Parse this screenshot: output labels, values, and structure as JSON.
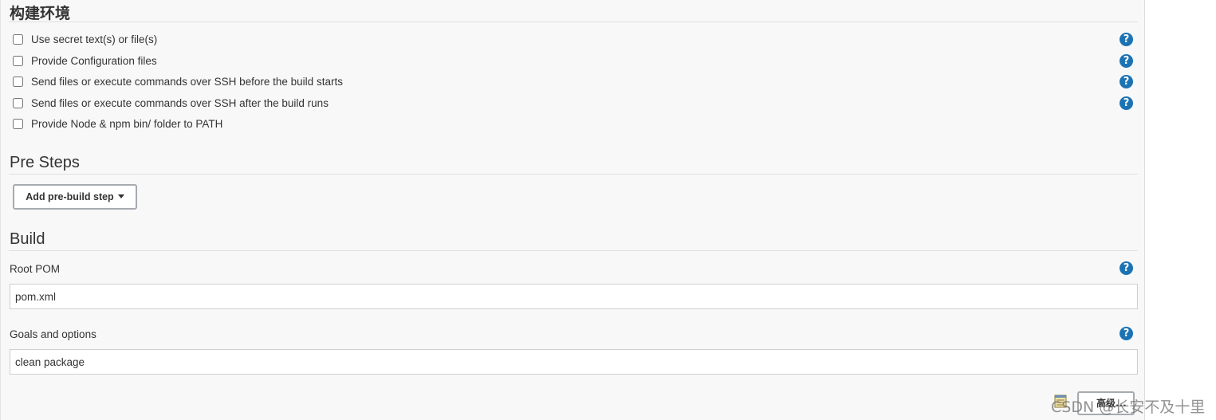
{
  "build_env": {
    "title": "构建环境",
    "options": [
      {
        "label": "Use secret text(s) or file(s)",
        "checked": false,
        "has_help": true
      },
      {
        "label": "Provide Configuration files",
        "checked": false,
        "has_help": true
      },
      {
        "label": "Send files or execute commands over SSH before the build starts",
        "checked": false,
        "has_help": true
      },
      {
        "label": "Send files or execute commands over SSH after the build runs",
        "checked": false,
        "has_help": true
      },
      {
        "label": "Provide Node & npm bin/ folder to PATH",
        "checked": false,
        "has_help": false
      }
    ]
  },
  "pre_steps": {
    "title": "Pre Steps",
    "add_button_label": "Add pre-build step"
  },
  "build": {
    "title": "Build",
    "root_pom": {
      "label": "Root POM",
      "value": "pom.xml"
    },
    "goals": {
      "label": "Goals and options",
      "value": "clean package"
    },
    "advanced_button_label": "高级..."
  },
  "help_glyph": "?",
  "watermark": "CSDN @长安不及十里",
  "icons": {
    "help": "help-icon",
    "caret": "caret-down-icon",
    "advanced": "notepad-icon"
  },
  "colors": {
    "help_icon": "#1b73b3",
    "panel_bg": "#f8f8f8",
    "text": "#333333"
  }
}
